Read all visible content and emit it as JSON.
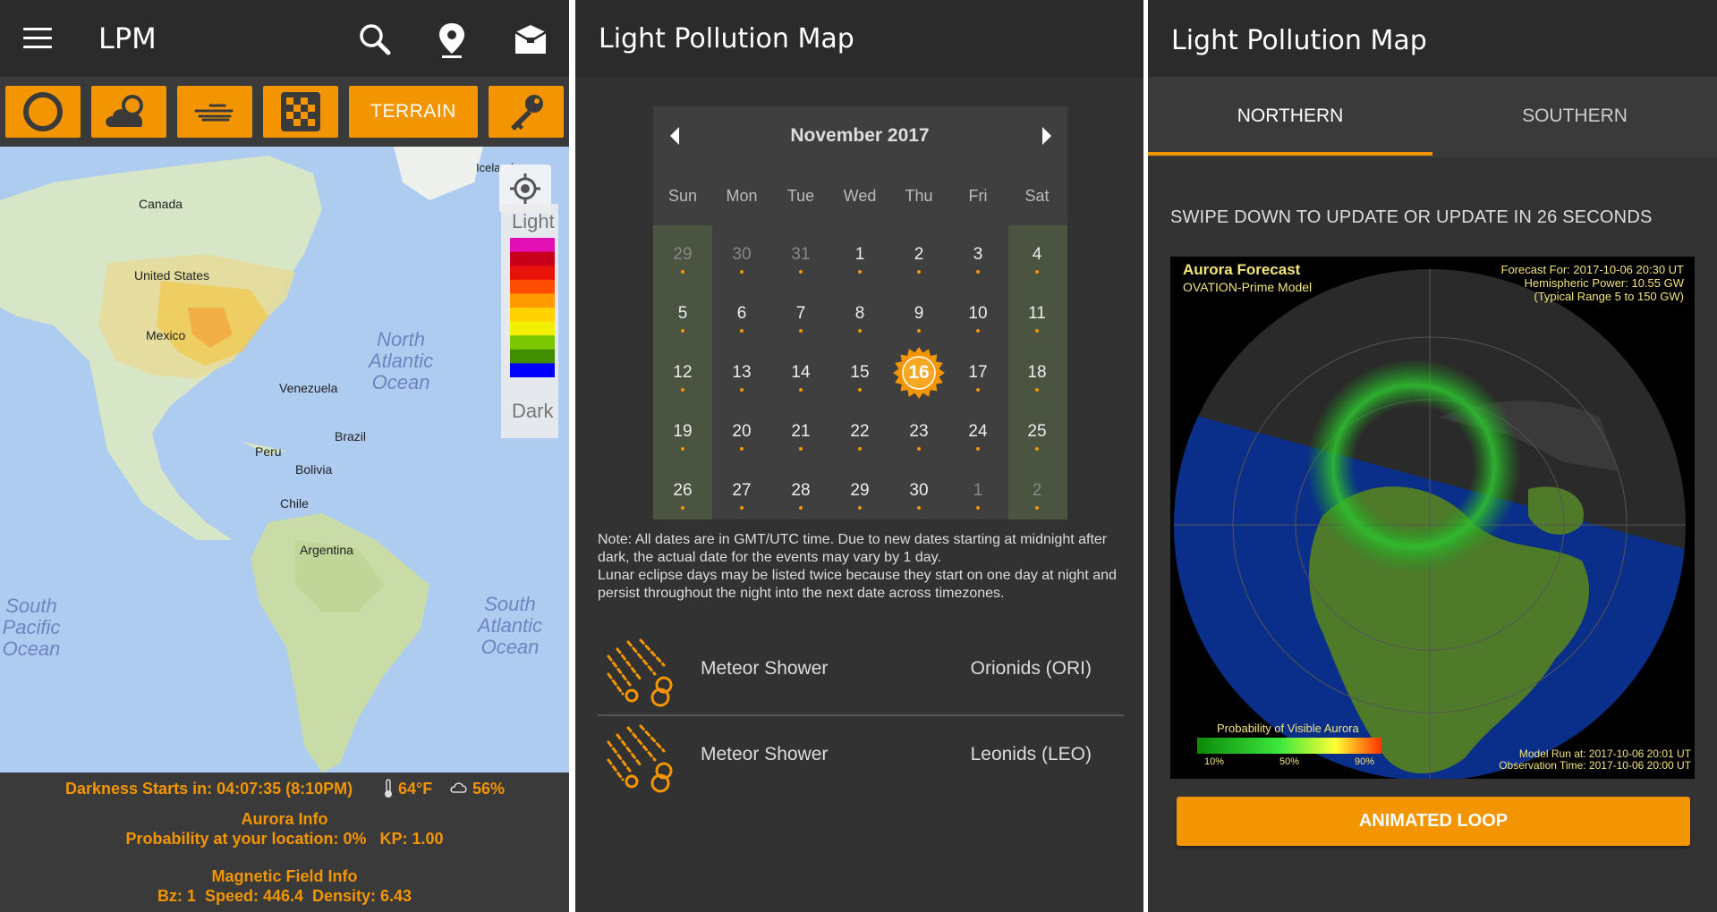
{
  "panel1": {
    "title": "LPM",
    "toolbar": {
      "terrain_label": "TERRAIN"
    },
    "map": {
      "labels": [
        "Canada",
        "United States",
        "Mexico",
        "Venezuela",
        "Peru",
        "Brazil",
        "Bolivia",
        "Chile",
        "Argentina",
        "Iceland"
      ],
      "oceans": {
        "north_atlantic": "North\nAtlantic\nOcean",
        "south_pacific": "South\nPacific\nOcean",
        "south_atlantic": "South\nAtlantic\nOcean"
      },
      "legend": {
        "top": "Light",
        "bottom": "Dark",
        "colors": [
          "#e20fb4",
          "#c8001a",
          "#e8120b",
          "#ff4d00",
          "#ff9a00",
          "#ffd200",
          "#f2ef00",
          "#7bc800",
          "#3f8f00",
          "#0000ff"
        ]
      }
    },
    "info": {
      "darkness": "Darkness Starts in: 04:07:35 (8:10PM)",
      "temp": "64°F",
      "cloud": "56%",
      "aurora_title": "Aurora Info",
      "aurora_line": "Probability at your location: 0%   KP: 1.00",
      "magnetic_title": "Magnetic Field Info",
      "magnetic_line": "Bz: 1  Speed: 446.4  Density: 6.43"
    }
  },
  "panel2": {
    "title": "Light Pollution Map",
    "calendar": {
      "month": "November 2017",
      "weekdays": [
        "Sun",
        "Mon",
        "Tue",
        "Wed",
        "Thu",
        "Fri",
        "Sat"
      ],
      "days": [
        [
          "29",
          "30",
          "31",
          "1",
          "2",
          "3",
          "4"
        ],
        [
          "5",
          "6",
          "7",
          "8",
          "9",
          "10",
          "11"
        ],
        [
          "12",
          "13",
          "14",
          "15",
          "16",
          "17",
          "18"
        ],
        [
          "19",
          "20",
          "21",
          "22",
          "23",
          "24",
          "25"
        ],
        [
          "26",
          "27",
          "28",
          "29",
          "30",
          "1",
          "2"
        ]
      ],
      "today": "16"
    },
    "note": "Note: All dates are in GMT/UTC time. Due to new dates starting at midnight after dark, the actual date for the events may vary by 1 day.\nLunar eclipse days may be listed twice because they start on one day at night and persist throughout the night into the next date across timezones.",
    "events": [
      {
        "type": "Meteor Shower",
        "name": "Orionids (ORI)"
      },
      {
        "type": "Meteor Shower",
        "name": "Leonids (LEO)"
      }
    ]
  },
  "panel3": {
    "title": "Light Pollution Map",
    "tabs": [
      "NORTHERN",
      "SOUTHERN"
    ],
    "active_tab": "NORTHERN",
    "swipe_text": "SWIPE DOWN TO UPDATE OR UPDATE IN 26 SECONDS",
    "forecast": {
      "title": "Aurora Forecast",
      "model": "OVATION-Prime Model",
      "forecast_for": "Forecast For: 2017-10-06 20:30 UT",
      "hemispheric_power": "Hemispheric Power: 10.55 GW",
      "typical_range": "(Typical Range 5 to 150 GW)",
      "probability_label": "Probability of Visible Aurora",
      "ticks": [
        "10%",
        "50%",
        "90%"
      ],
      "model_run": "Model Run at: 2017-10-06 20:01 UT",
      "observation": "Observation Time: 2017-10-06 20:00 UT"
    },
    "button": "ANIMATED LOOP"
  }
}
